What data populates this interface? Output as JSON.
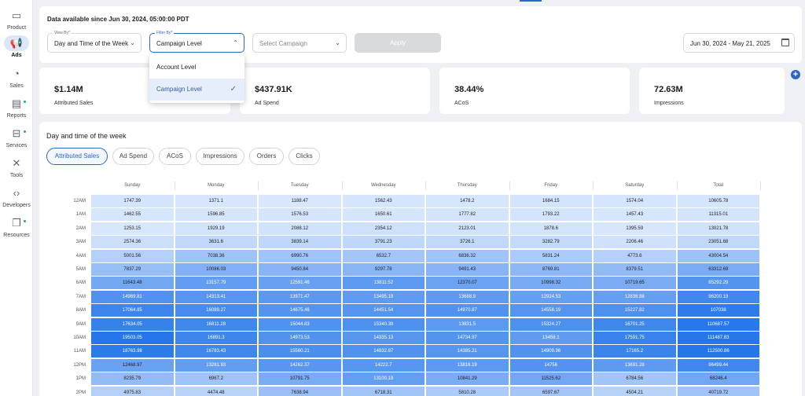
{
  "sidebar": {
    "items": [
      {
        "label": "Product",
        "icon": "box-icon",
        "glyph": "▭",
        "active": false,
        "dot": false
      },
      {
        "label": "Ads",
        "icon": "megaphone-icon",
        "glyph": "📢",
        "active": true,
        "dot": false
      },
      {
        "label": "Sales",
        "icon": "pie-chart-icon",
        "glyph": "◔",
        "active": false,
        "dot": false
      },
      {
        "label": "Reports",
        "icon": "report-icon",
        "glyph": "▤",
        "active": false,
        "dot": true
      },
      {
        "label": "Services",
        "icon": "briefcase-icon",
        "glyph": "⊟",
        "active": false,
        "dot": true
      },
      {
        "label": "Tools",
        "icon": "tools-icon",
        "glyph": "✕",
        "active": false,
        "dot": false
      },
      {
        "label": "Developers",
        "icon": "code-icon",
        "glyph": "‹›",
        "active": false,
        "dot": false
      },
      {
        "label": "Resources",
        "icon": "book-icon",
        "glyph": "❐",
        "active": false,
        "dot": true
      }
    ]
  },
  "filters": {
    "since": "Data available since Jun 30, 2024, 05:00:00 PDT",
    "view_by": {
      "caption": "View By*",
      "value": "Day and Time of the Week"
    },
    "filter_by": {
      "caption": "Filter By*",
      "value": "Campaign Level"
    },
    "campaign": {
      "placeholder": "Select Campaign"
    },
    "apply": "Apply",
    "date_range": "Jun 30, 2024 - May 21, 2025"
  },
  "dropdown": {
    "options": [
      {
        "label": "Account Level",
        "selected": false
      },
      {
        "label": "Campaign Level",
        "selected": true
      }
    ]
  },
  "kpis": [
    {
      "value": "$1.14M",
      "label": "Attributed Sales"
    },
    {
      "value": "$437.91K",
      "label": "Ad Spend"
    },
    {
      "value": "38.44%",
      "label": "ACoS"
    },
    {
      "value": "72.63M",
      "label": "Impressions"
    }
  ],
  "main": {
    "title": "Day and time of the week",
    "tabs": [
      {
        "label": "Attributed Sales",
        "active": true
      },
      {
        "label": "Ad Spend",
        "active": false
      },
      {
        "label": "ACoS",
        "active": false
      },
      {
        "label": "Impressions",
        "active": false
      },
      {
        "label": "Orders",
        "active": false
      },
      {
        "label": "Clicks",
        "active": false
      }
    ],
    "columns": [
      "Sunday",
      "Monday",
      "Tuesday",
      "Wednesday",
      "Thursday",
      "Friday",
      "Saturday",
      "Total"
    ],
    "rows": [
      {
        "label": "12AM",
        "values": [
          "1747.39",
          "1371.1",
          "1188.47",
          "1562.43",
          "1478.2",
          "1684.15",
          "1574.04",
          "10605.78"
        ]
      },
      {
        "label": "1AM",
        "values": [
          "1462.55",
          "1596.85",
          "1576.53",
          "1650.61",
          "1777.82",
          "1793.22",
          "1457.43",
          "11315.01"
        ]
      },
      {
        "label": "2AM",
        "values": [
          "1253.15",
          "1929.19",
          "2088.12",
          "2354.12",
          "2123.01",
          "1878.6",
          "1395.59",
          "13021.78"
        ]
      },
      {
        "label": "3AM",
        "values": [
          "2574.36",
          "3631.6",
          "3839.14",
          "3791.23",
          "3726.1",
          "3282.79",
          "2206.46",
          "23051.68"
        ]
      },
      {
        "label": "4AM",
        "values": [
          "5001.56",
          "7038.36",
          "6990.76",
          "6532.7",
          "6836.32",
          "5831.24",
          "4773.6",
          "43004.54"
        ]
      },
      {
        "label": "5AM",
        "values": [
          "7837.29",
          "10086.03",
          "9450.84",
          "9297.78",
          "9491.43",
          "8769.81",
          "8379.51",
          "63312.69"
        ]
      },
      {
        "label": "6AM",
        "values": [
          "11643.48",
          "13157.79",
          "12591.46",
          "13811.52",
          "12370.07",
          "10998.32",
          "10719.65",
          "85292.29"
        ]
      },
      {
        "label": "7AM",
        "values": [
          "14969.81",
          "14313.41",
          "13971.47",
          "13495.19",
          "13688.9",
          "12924.53",
          "12836.88",
          "96200.19"
        ]
      },
      {
        "label": "8AM",
        "values": [
          "17064.85",
          "16089.27",
          "14675.46",
          "14451.54",
          "14970.87",
          "14558.19",
          "15227.82",
          "107038"
        ]
      },
      {
        "label": "9AM",
        "values": [
          "17634.05",
          "16811.28",
          "15044.83",
          "15340.39",
          "13831.5",
          "15324.27",
          "16701.25",
          "110687.57"
        ]
      },
      {
        "label": "10AM",
        "values": [
          "19503.05",
          "16891.3",
          "14973.53",
          "14335.13",
          "14734.97",
          "13458.1",
          "17591.75",
          "111487.83"
        ]
      },
      {
        "label": "11AM",
        "values": [
          "18763.98",
          "16783.43",
          "15560.21",
          "14932.87",
          "14385.21",
          "14909.96",
          "17165.2",
          "112500.86"
        ]
      },
      {
        "label": "12PM",
        "values": [
          "12468.97",
          "13281.93",
          "14262.37",
          "14222.7",
          "13816.19",
          "14756",
          "13691.28",
          "96499.44"
        ]
      },
      {
        "label": "1PM",
        "values": [
          "8235.79",
          "6967.2",
          "10791.75",
          "13100.19",
          "10841.29",
          "11525.62",
          "6784.56",
          "68246.4"
        ]
      },
      {
        "label": "2PM",
        "values": [
          "4975.83",
          "4474.48",
          "7638.94",
          "6718.31",
          "5810.28",
          "6597.67",
          "4504.21",
          "40719.72"
        ]
      }
    ]
  }
}
